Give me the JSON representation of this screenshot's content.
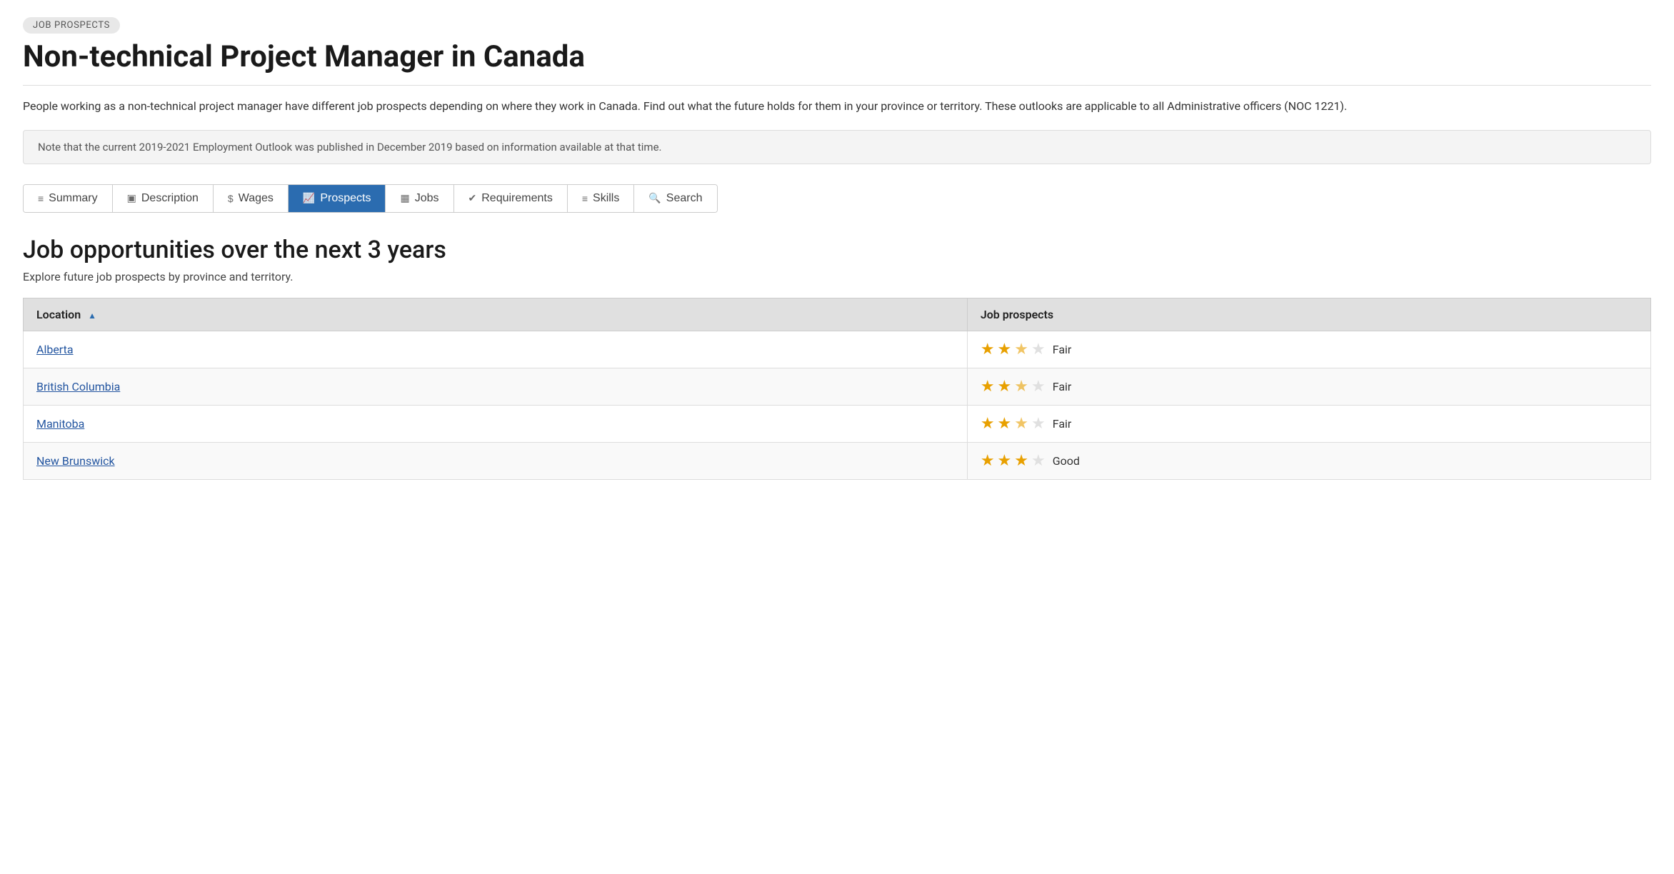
{
  "badge": "JOB PROSPECTS",
  "page_title": "Non-technical Project Manager in Canada",
  "description": "People working as a non-technical project manager have different job prospects depending on where they work in Canada. Find out what the future holds for them in your province or territory. These outlooks are applicable to all Administrative officers (NOC 1221).",
  "notice": "Note that the current 2019-2021 Employment Outlook was published in December 2019 based on information available at that time.",
  "tabs": [
    {
      "id": "summary",
      "label": "Summary",
      "icon": "≡",
      "active": false
    },
    {
      "id": "description",
      "label": "Description",
      "icon": "▣",
      "active": false
    },
    {
      "id": "wages",
      "label": "Wages",
      "icon": "$",
      "active": false
    },
    {
      "id": "prospects",
      "label": "Prospects",
      "icon": "📈",
      "active": true
    },
    {
      "id": "jobs",
      "label": "Jobs",
      "icon": "▦",
      "active": false
    },
    {
      "id": "requirements",
      "label": "Requirements",
      "icon": "✔",
      "active": false
    },
    {
      "id": "skills",
      "label": "Skills",
      "icon": "≡",
      "active": false
    },
    {
      "id": "search",
      "label": "Search",
      "icon": "🔍",
      "active": false
    }
  ],
  "section_title": "Job opportunities over the next 3 years",
  "section_subtitle": "Explore future job prospects by province and territory.",
  "table": {
    "headers": [
      "Location",
      "Job prospects"
    ],
    "rows": [
      {
        "location": "Alberta",
        "stars": 2.5,
        "label": "Fair"
      },
      {
        "location": "British Columbia",
        "stars": 2.5,
        "label": "Fair"
      },
      {
        "location": "Manitoba",
        "stars": 2.5,
        "label": "Fair"
      },
      {
        "location": "New Brunswick",
        "stars": 3,
        "label": "Good"
      }
    ]
  }
}
